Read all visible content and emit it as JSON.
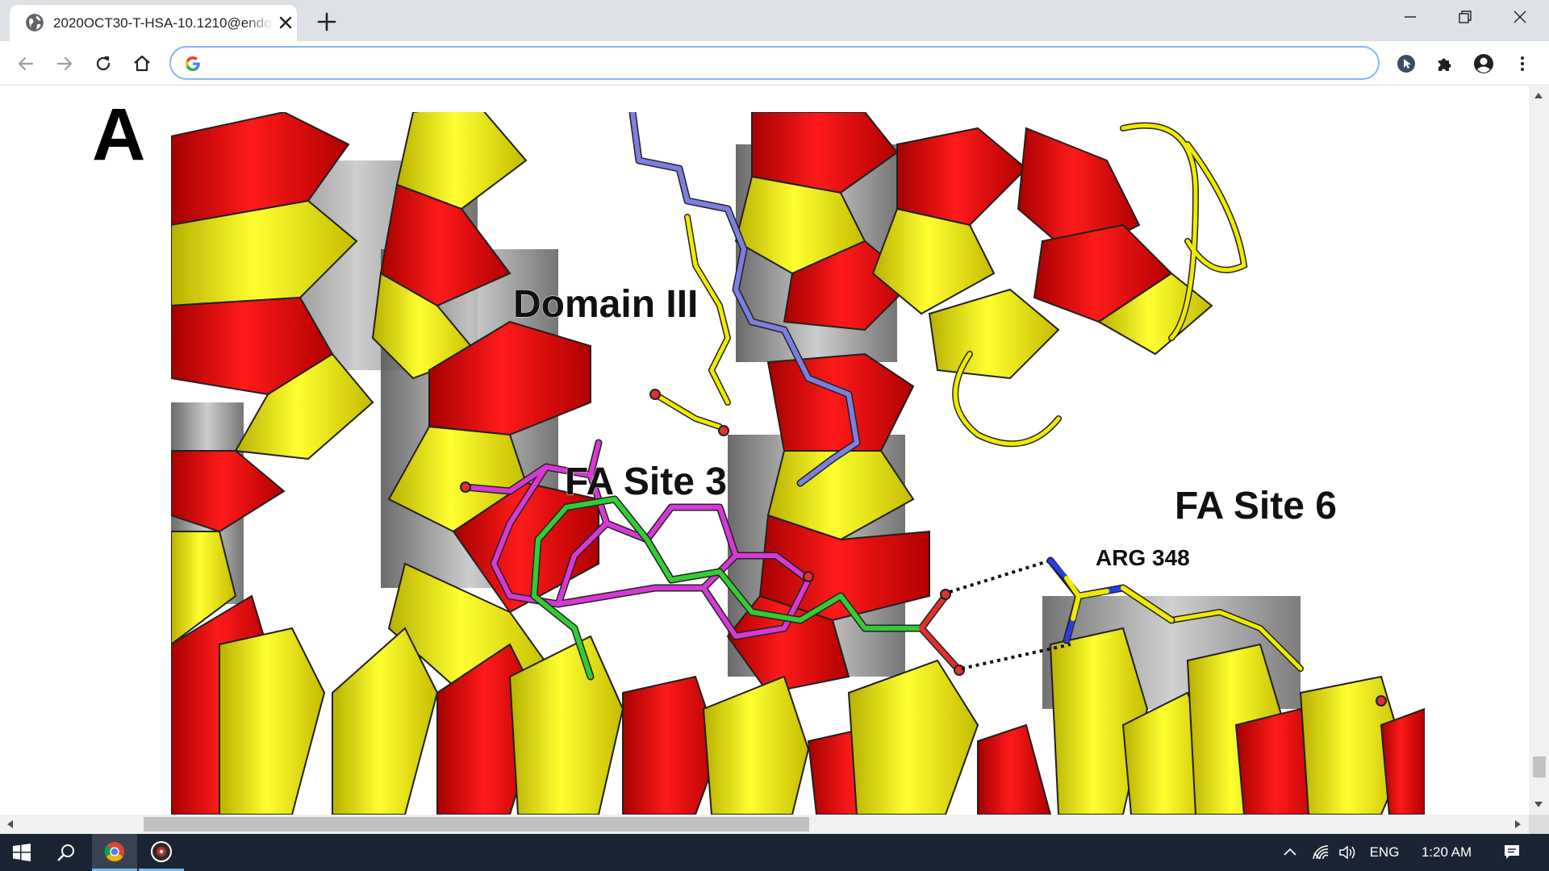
{
  "browser": {
    "tab_title": "2020OCT30-T-HSA-10.1210@endo",
    "address_value": "",
    "address_placeholder": ""
  },
  "figure": {
    "panel_letter": "A",
    "labels": {
      "domain": "Domain III",
      "fa_site_3": "FA Site 3",
      "fa_site_6": "FA Site 6",
      "residue": "ARG 348"
    },
    "colors": {
      "helix_red": "#e60000",
      "helix_yellow": "#f0ea00",
      "helix_inside": "#8a8a8a",
      "ligand_blue": "#7b7fe0",
      "ligand_magenta": "#d63ad6",
      "ligand_green": "#33cc33",
      "oxygen": "#e03030",
      "nitrogen": "#2a3fe0"
    }
  },
  "taskbar": {
    "language": "ENG",
    "time": "1:20 AM"
  },
  "icons": {
    "tab_favicon": "globe-icon",
    "tab_close": "close-icon",
    "new_tab": "plus-icon",
    "minimize": "minimize-icon",
    "restore": "restore-icon",
    "close_window": "close-window-icon",
    "back": "back-arrow-icon",
    "forward": "forward-arrow-icon",
    "reload": "reload-icon",
    "home": "home-icon",
    "google": "google-g-icon",
    "extension_cursor": "cursor-extension-icon",
    "extensions": "puzzle-icon",
    "profile": "profile-icon",
    "menu": "kebab-menu-icon",
    "start": "windows-start-icon",
    "search": "search-icon",
    "chrome_app": "chrome-icon",
    "media_app": "media-app-icon",
    "tray_up": "chevron-up-icon",
    "wifi": "wifi-icon",
    "volume": "speaker-icon",
    "notifications": "notification-icon"
  }
}
